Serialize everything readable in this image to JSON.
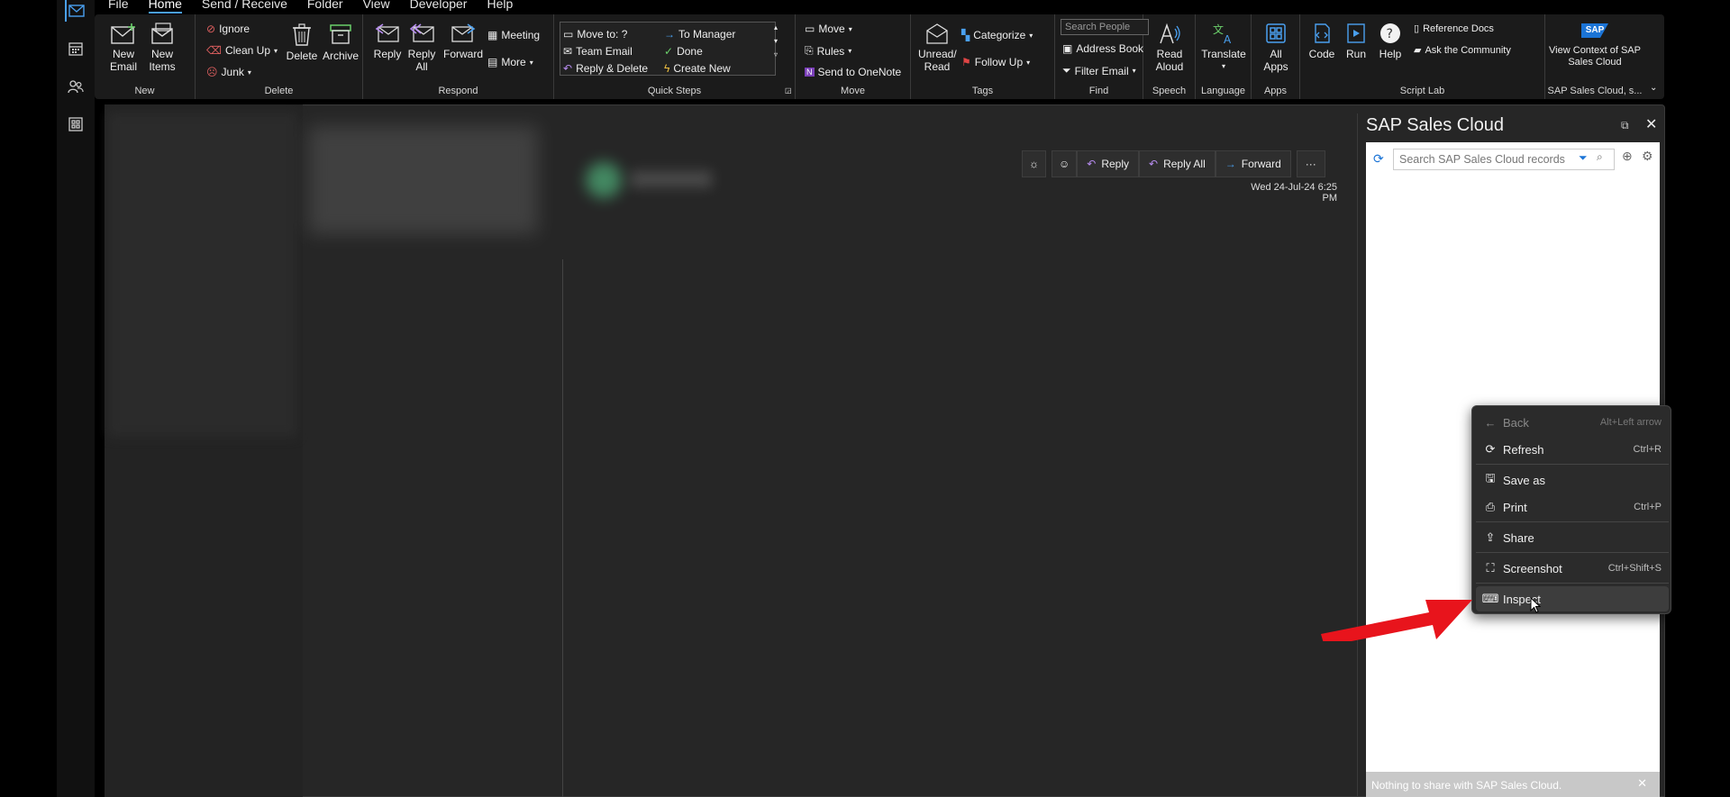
{
  "menubar": {
    "items": [
      "File",
      "Home",
      "Send / Receive",
      "Folder",
      "View",
      "Developer",
      "Help"
    ],
    "active": "Home"
  },
  "ribbon": {
    "new": {
      "label": "New",
      "new_email": "New Email",
      "new_items": "New Items"
    },
    "delete": {
      "label": "Delete",
      "ignore": "Ignore",
      "clean_up": "Clean Up",
      "junk": "Junk",
      "delete": "Delete",
      "archive": "Archive"
    },
    "respond": {
      "label": "Respond",
      "reply": "Reply",
      "reply_all": "Reply All",
      "forward": "Forward",
      "meeting": "Meeting",
      "more": "More"
    },
    "quick_steps": {
      "label": "Quick Steps",
      "move_to": "Move to: ?",
      "team_email": "Team Email",
      "reply_delete": "Reply & Delete",
      "to_manager": "To Manager",
      "done": "Done",
      "create_new": "Create New"
    },
    "move": {
      "label": "Move",
      "move": "Move",
      "rules": "Rules",
      "onenote": "Send to OneNote"
    },
    "tags": {
      "label": "Tags",
      "unread_read": "Unread/ Read",
      "categorize": "Categorize",
      "follow_up": "Follow Up"
    },
    "find": {
      "label": "Find",
      "search_people": "Search People",
      "address_book": "Address Book",
      "filter_email": "Filter Email"
    },
    "speech": {
      "label": "Speech",
      "read_aloud": "Read Aloud"
    },
    "language": {
      "label": "Language",
      "translate": "Translate"
    },
    "apps": {
      "label": "Apps",
      "all_apps": "All Apps"
    },
    "script_lab": {
      "label": "Script Lab",
      "code": "Code",
      "run": "Run",
      "help": "Help",
      "reference_docs": "Reference Docs",
      "ask_community": "Ask the Community"
    },
    "sap": {
      "label": "SAP Sales Cloud, s...",
      "view_context": "View Context of SAP Sales Cloud",
      "logo": "SAP"
    }
  },
  "reading": {
    "reply": "Reply",
    "reply_all": "Reply All",
    "forward": "Forward",
    "date": "Wed 24-Jul-24 6:25 PM"
  },
  "sap_pane": {
    "title": "SAP Sales Cloud",
    "search_placeholder": "Search SAP Sales Cloud records",
    "footer": "Nothing to share with SAP Sales Cloud."
  },
  "context_menu": {
    "items": [
      {
        "label": "Back",
        "shortcut": "Alt+Left arrow",
        "icon": "back-arrow-icon",
        "disabled": true
      },
      {
        "label": "Refresh",
        "shortcut": "Ctrl+R",
        "icon": "refresh-icon"
      },
      {
        "label": "Save as",
        "shortcut": "",
        "icon": "save-as-icon"
      },
      {
        "label": "Print",
        "shortcut": "Ctrl+P",
        "icon": "print-icon"
      },
      {
        "label": "Share",
        "shortcut": "",
        "icon": "share-icon"
      },
      {
        "label": "Screenshot",
        "shortcut": "Ctrl+Shift+S",
        "icon": "screenshot-icon"
      },
      {
        "label": "Inspect",
        "shortcut": "",
        "icon": "inspect-icon",
        "hovered": true
      }
    ]
  },
  "colors": {
    "accent": "#4aa0f0",
    "annotation_arrow": "#e8141c",
    "sap_blue": "#1b74d6"
  }
}
